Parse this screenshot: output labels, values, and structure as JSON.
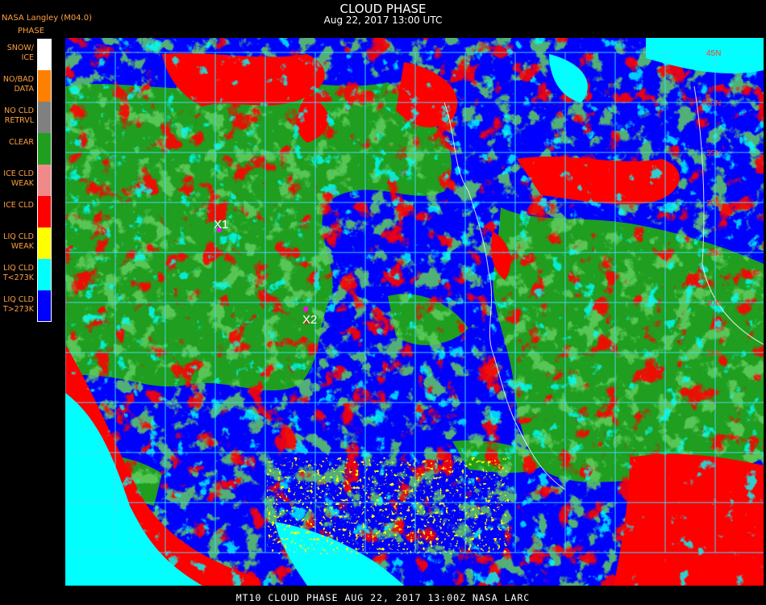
{
  "header": {
    "title": "CLOUD PHASE",
    "subtitle": "Aug 22, 2017 13:00 UTC"
  },
  "agency": "NASA Langley (M04.0)",
  "legend": {
    "title": "PHASE",
    "items": [
      {
        "label": "SNOW/\nICE",
        "color": "#ffffff"
      },
      {
        "label": "NO/BAD\nDATA",
        "color": "#ff8000"
      },
      {
        "label": "NO CLD\nRETRVL",
        "color": "#808080"
      },
      {
        "label": "CLEAR",
        "color": "#1f9e1f"
      },
      {
        "label": "ICE CLD\nWEAK",
        "color": "#f08a8a"
      },
      {
        "label": "ICE CLD",
        "color": "#ff0000"
      },
      {
        "label": "LIQ CLD\nWEAK",
        "color": "#ffff00"
      },
      {
        "label": "LIQ CLD\nT<273K",
        "color": "#00ffff"
      },
      {
        "label": "LIQ CLD\nT>273K",
        "color": "#0000ff"
      }
    ]
  },
  "markers": [
    {
      "label": "X1",
      "color": "#ff00ff"
    },
    {
      "label": "X2",
      "color": "#ff00ff"
    }
  ],
  "lat_labels": [
    "45N",
    "40N",
    "35N",
    "30N",
    "25N",
    "20N",
    "15N"
  ],
  "footer": "MT10   CLOUD PHASE   AUG 22, 2017 13:00Z   NASA LARC",
  "colors": {
    "grid": "#40e0ff",
    "label_text": "#ffa040",
    "ocean_liquid": "#0000ff",
    "land_clear": "#1f9e1f"
  }
}
